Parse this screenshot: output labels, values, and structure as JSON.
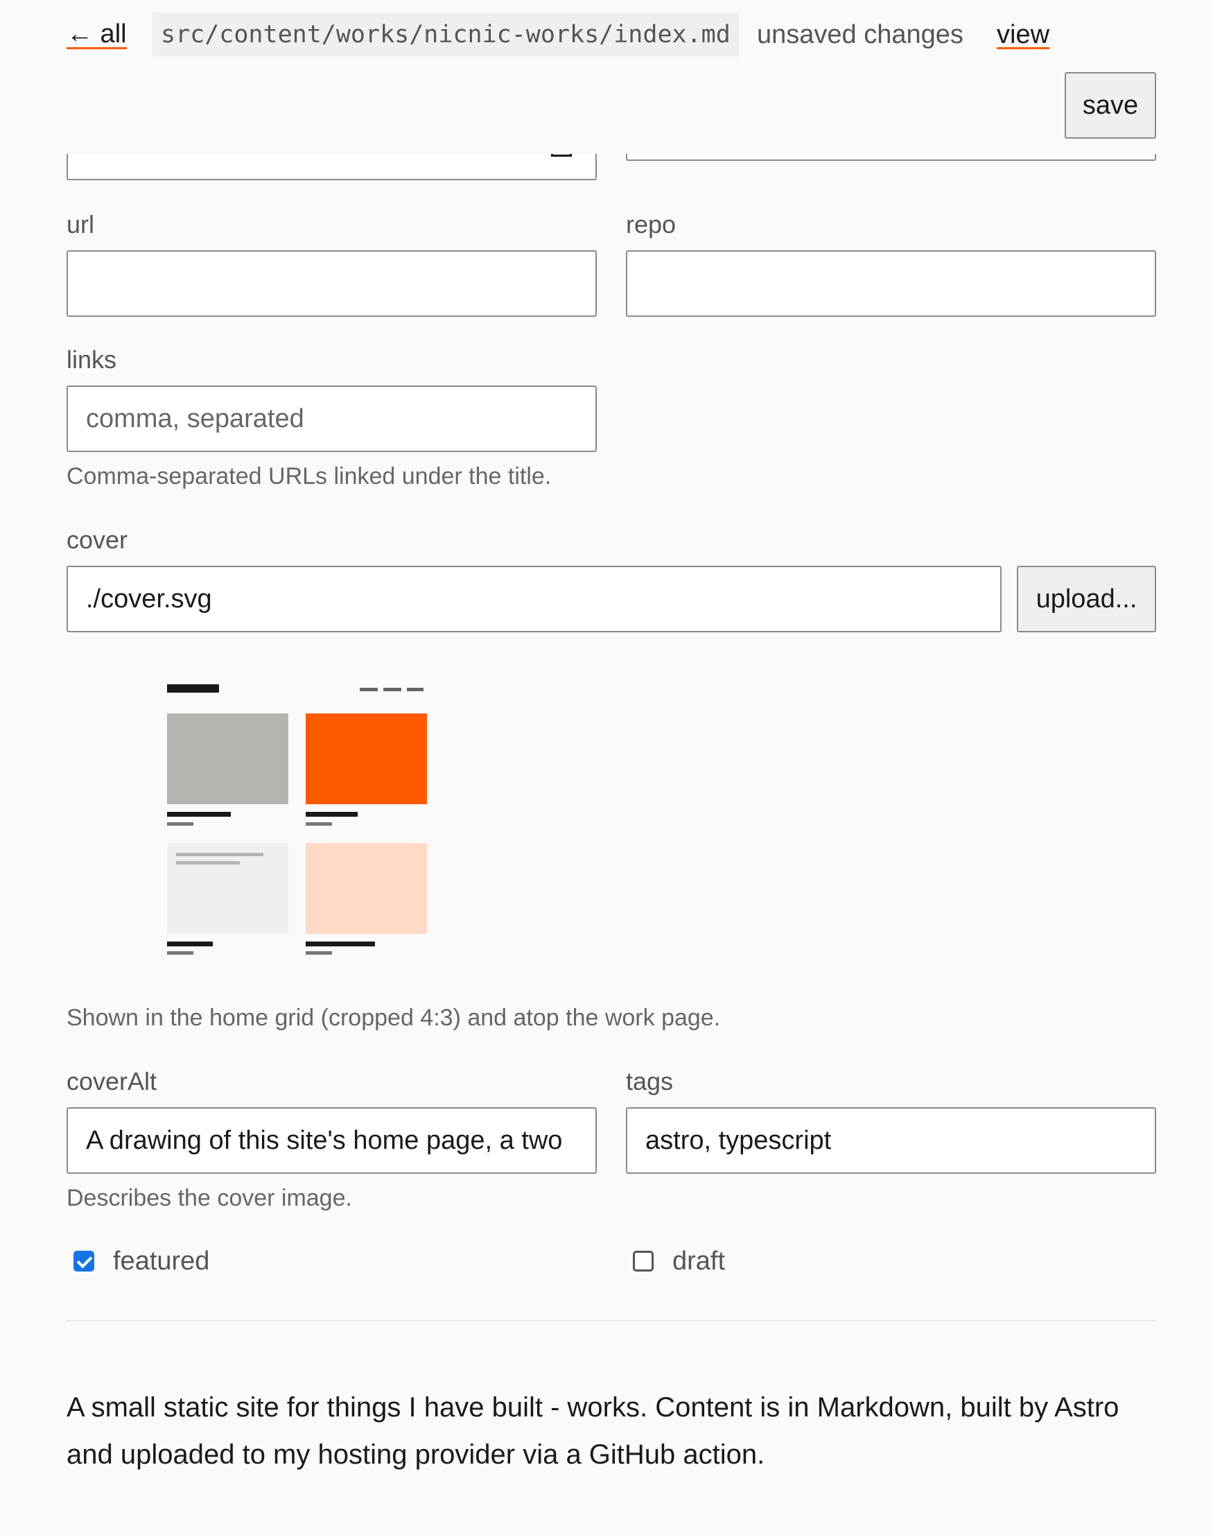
{
  "header": {
    "back_label": "← all",
    "file_path": "src/content/works/nicnic-works/index.md",
    "status": "unsaved changes",
    "view_label": "view",
    "save_label": "save"
  },
  "fields": {
    "url": {
      "label": "url",
      "value": ""
    },
    "repo": {
      "label": "repo",
      "value": ""
    },
    "links": {
      "label": "links",
      "value": "",
      "placeholder": "comma, separated",
      "hint": "Comma-separated URLs linked under the title."
    },
    "cover": {
      "label": "cover",
      "value": "./cover.svg",
      "upload_label": "upload...",
      "hint": "Shown in the home grid (cropped 4:3) and atop the work page."
    },
    "coverAlt": {
      "label": "coverAlt",
      "value": "A drawing of this site's home page, a two",
      "hint": "Describes the cover image."
    },
    "tags": {
      "label": "tags",
      "value": "astro, typescript"
    },
    "featured": {
      "label": "featured",
      "checked": true
    },
    "draft": {
      "label": "draft",
      "checked": false
    }
  },
  "body": {
    "text": "A small static site for things I have built - works. Content is in Markdown, built by Astro and uploaded to my hosting provider via a GitHub action."
  },
  "colors": {
    "accent": "#ff5a00",
    "checkbox": "#1673e6",
    "cover_gray": "#b5b5b0",
    "cover_orange": "#ff5a00",
    "cover_light": "#efefed",
    "cover_peach": "#ffdac6"
  }
}
